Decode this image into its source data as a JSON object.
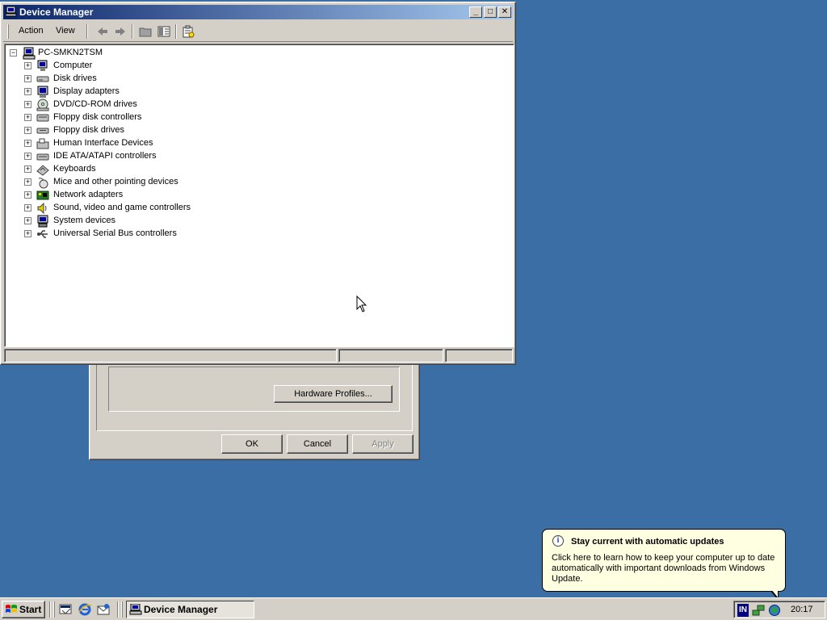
{
  "window": {
    "title": "Device Manager",
    "menu": [
      "Action",
      "View"
    ]
  },
  "tree": {
    "root": "PC-SMKN2TSM",
    "items": [
      {
        "label": "Computer",
        "icon": "computer-icon"
      },
      {
        "label": "Disk drives",
        "icon": "disk-drive-icon"
      },
      {
        "label": "Display adapters",
        "icon": "display-adapter-icon"
      },
      {
        "label": "DVD/CD-ROM drives",
        "icon": "cdrom-icon"
      },
      {
        "label": "Floppy disk controllers",
        "icon": "floppy-controller-icon"
      },
      {
        "label": "Floppy disk drives",
        "icon": "floppy-drive-icon"
      },
      {
        "label": "Human Interface Devices",
        "icon": "hid-icon"
      },
      {
        "label": "IDE ATA/ATAPI controllers",
        "icon": "ide-controller-icon"
      },
      {
        "label": "Keyboards",
        "icon": "keyboard-icon"
      },
      {
        "label": "Mice and other pointing devices",
        "icon": "mouse-icon"
      },
      {
        "label": "Network adapters",
        "icon": "network-adapter-icon"
      },
      {
        "label": "Sound, video and game controllers",
        "icon": "sound-icon"
      },
      {
        "label": "System devices",
        "icon": "system-devices-icon"
      },
      {
        "label": "Universal Serial Bus controllers",
        "icon": "usb-icon"
      }
    ]
  },
  "dialog": {
    "hardware_profiles": "Hardware Profiles...",
    "ok": "OK",
    "cancel": "Cancel",
    "apply": "Apply"
  },
  "balloon": {
    "title": "Stay current with automatic updates",
    "text": "Click here to learn how to keep your computer up to date automatically with important downloads from Windows Update."
  },
  "taskbar": {
    "start": "Start",
    "task": "Device Manager",
    "tray_lang": "IN",
    "clock": "20:17"
  }
}
